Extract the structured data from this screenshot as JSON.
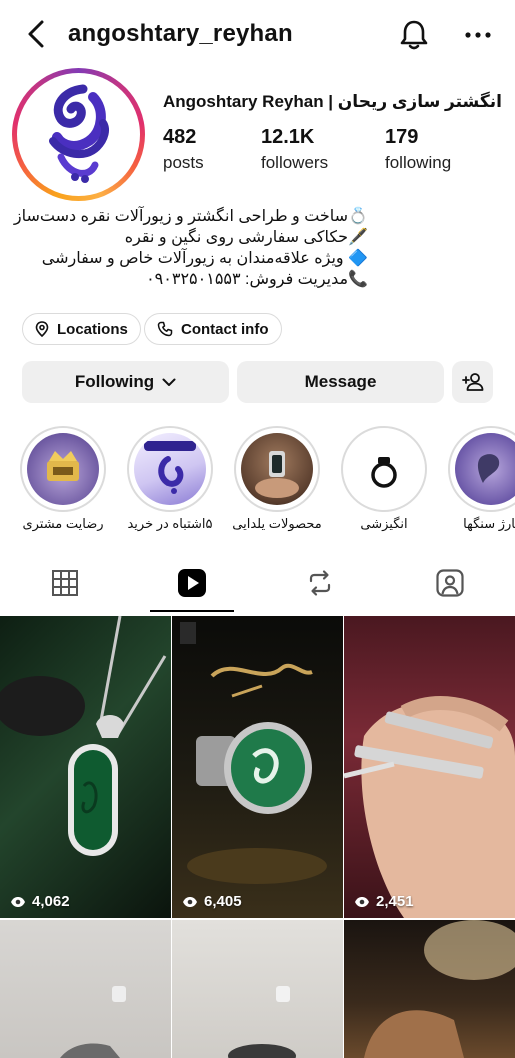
{
  "header": {
    "username": "angoshtary_reyhan"
  },
  "profile": {
    "display_name": "Angoshtary Reyhan | انگشتر سازی ریحان",
    "stats": [
      {
        "value": "482",
        "label": "posts"
      },
      {
        "value": "12.1K",
        "label": "followers"
      },
      {
        "value": "179",
        "label": "following"
      }
    ],
    "bio": [
      "💍ساخت و طراحی انگشتر و زیورآلات نقره دست‌ساز",
      "🖋️حکاکی سفارشی روی نگین و نقره",
      "🔷 ویژه علاقه‌مندان به زیورآلات خاص و سفارشی",
      "📞مدیریت فروش: ۰۹۰۳۲۵۰۱۵۵۳"
    ]
  },
  "pills": {
    "locations": "Locations",
    "contact": "Contact info"
  },
  "actions": {
    "following": "Following",
    "message": "Message"
  },
  "highlights": [
    {
      "label": "رضایت مشتری"
    },
    {
      "label": "۵اشتباه در خرید"
    },
    {
      "label": "محصولات یلدایی"
    },
    {
      "label": "انگیزشی"
    },
    {
      "label": "بارژ سنگها"
    }
  ],
  "posts": [
    {
      "views": "4,062"
    },
    {
      "views": "6,405"
    },
    {
      "views": "2,451"
    }
  ],
  "colors": {
    "button_bg": "#efefef",
    "logo_purple": "#3b2aa8",
    "green_stone": "#1f7a4a"
  }
}
